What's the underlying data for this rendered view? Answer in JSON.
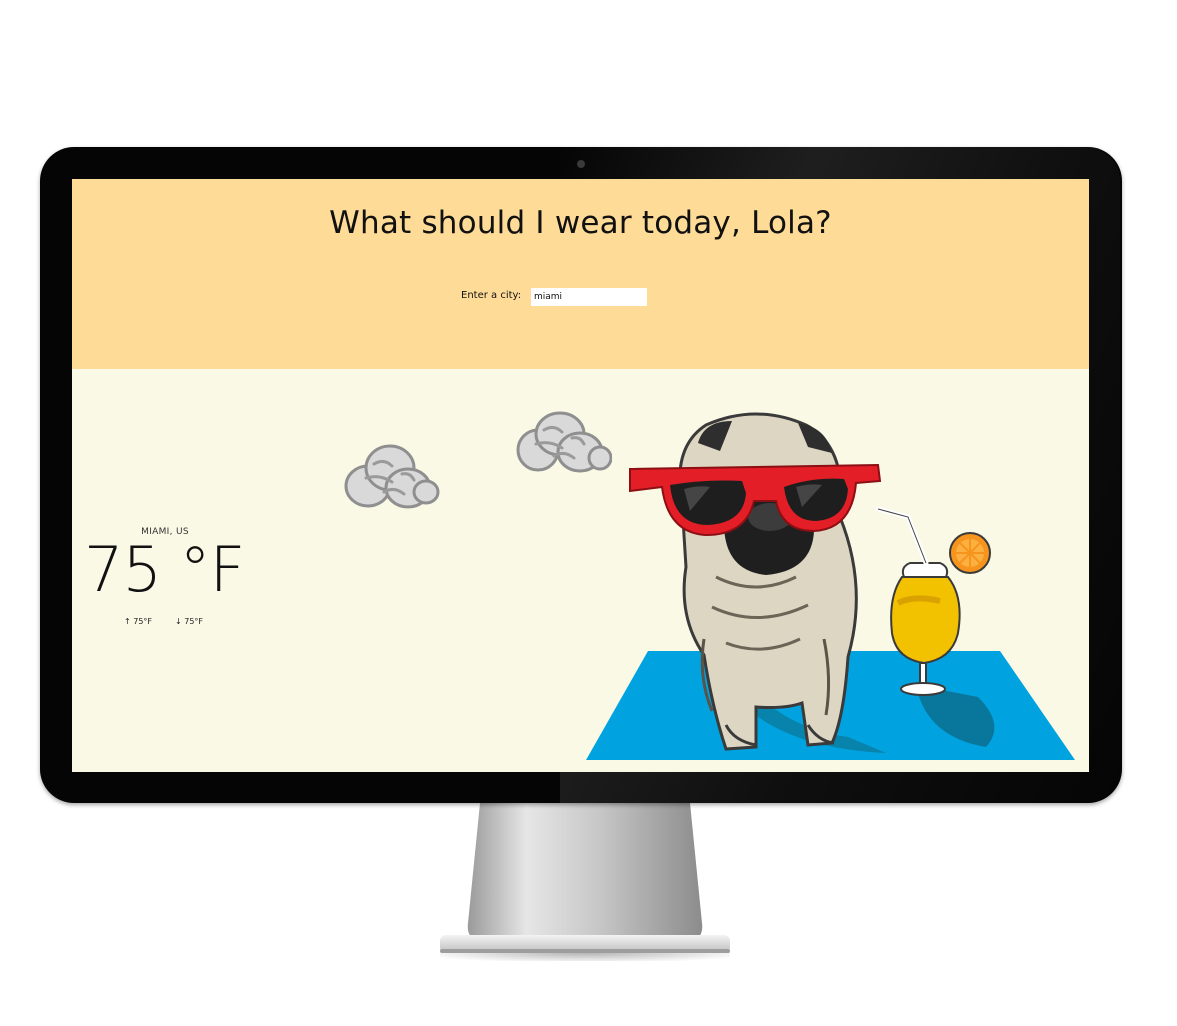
{
  "page": {
    "title": "What should I wear today, Lola?"
  },
  "search": {
    "label": "Enter a city:",
    "value": "miami"
  },
  "weather": {
    "location": "MIAMI, US",
    "temperature": "75 °F",
    "high": "↑ 75°F",
    "low": "↓ 75°F"
  },
  "colors": {
    "header_background": "#fedc98",
    "content_background": "#faf9e6",
    "mat_blue": "#00a3e0",
    "glasses_red": "#e41e26"
  },
  "icons": {
    "cloud_1": "cloud-icon",
    "cloud_2": "cloud-icon",
    "illustration": "pug-with-sunglasses-and-drink"
  }
}
